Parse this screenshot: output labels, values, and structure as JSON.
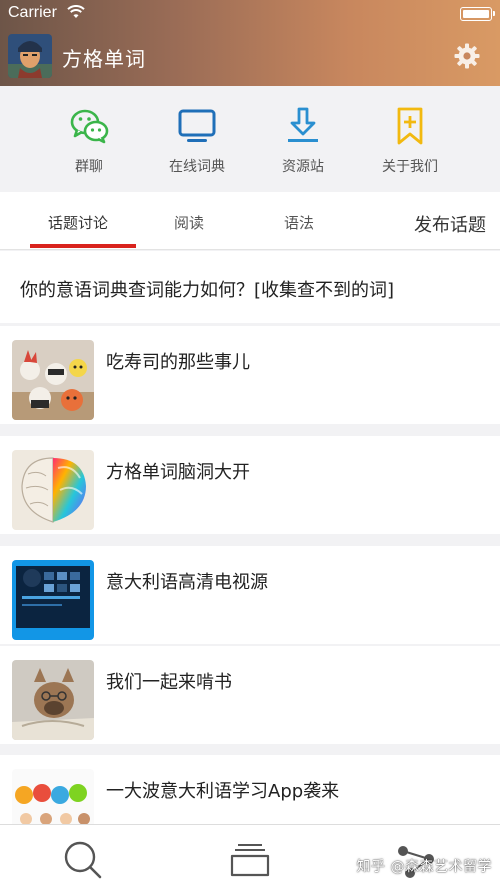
{
  "status_bar": {
    "carrier": "Carrier"
  },
  "header": {
    "title": "方格单词"
  },
  "quick_actions": [
    {
      "label": "群聊",
      "icon": "wechat-icon",
      "color": "#3bb54a"
    },
    {
      "label": "在线词典",
      "icon": "monitor-icon",
      "color": "#1f6fb8"
    },
    {
      "label": "资源站",
      "icon": "download-icon",
      "color": "#2a8fd0"
    },
    {
      "label": "关于我们",
      "icon": "bookmark-plus-icon",
      "color": "#f2b90f"
    }
  ],
  "tabs": [
    {
      "label": "话题讨论",
      "active": true
    },
    {
      "label": "阅读",
      "active": false
    },
    {
      "label": "语法",
      "active": false
    }
  ],
  "publish_label": "发布话题",
  "banner": "你的意语词典查词能力如何？[收集查不到的词]",
  "topics": [
    {
      "title": "吃寿司的那些事儿",
      "thumb": "sushi-image"
    },
    {
      "title": "方格单词脑洞大开",
      "thumb": "brain-image"
    },
    {
      "title": "意大利语高清电视源",
      "thumb": "tv-screen-image"
    },
    {
      "title": "我们一起来啃书",
      "thumb": "dog-reading-image"
    },
    {
      "title": "一大波意大利语学习App袭来",
      "thumb": "people-chat-image"
    }
  ],
  "bottom_nav": [
    {
      "icon": "search-icon"
    },
    {
      "icon": "archive-icon"
    },
    {
      "icon": "share-icon"
    }
  ],
  "watermark": "知乎 @森森艺术留学",
  "colors": {
    "accent_red": "#d9231d"
  }
}
